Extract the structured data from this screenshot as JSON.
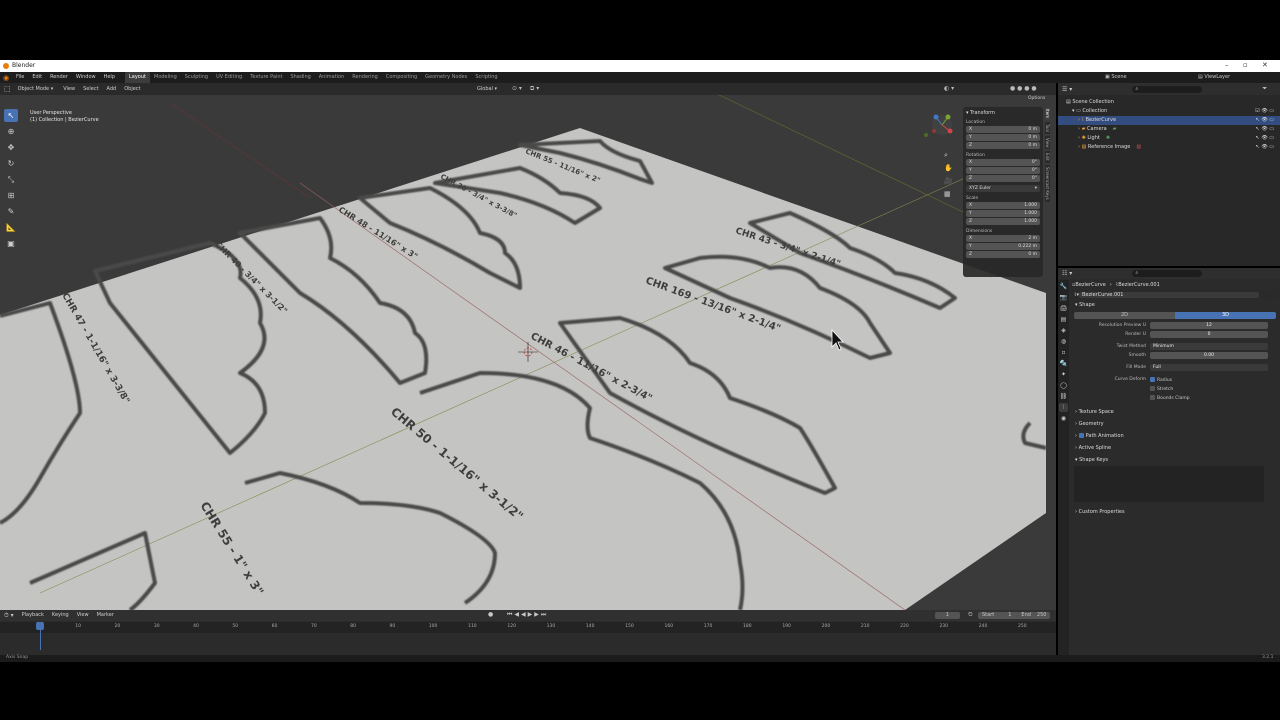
{
  "window": {
    "title": "Blender"
  },
  "menu": [
    "File",
    "Edit",
    "Render",
    "Window",
    "Help"
  ],
  "workspaces": [
    "Layout",
    "Modeling",
    "Sculpting",
    "UV Editing",
    "Texture Paint",
    "Shading",
    "Animation",
    "Rendering",
    "Compositing",
    "Geometry Nodes",
    "Scripting"
  ],
  "scene": {
    "label": "Scene",
    "viewlayer": "ViewLayer"
  },
  "viewport": {
    "mode": "Object Mode",
    "menus": [
      "View",
      "Select",
      "Add",
      "Object"
    ],
    "transform_orientation": "Global",
    "overlay_title": "User Perspective",
    "overlay_sub": "(1) Collection | BezierCurve",
    "options": "Options"
  },
  "profiles": [
    {
      "label": "CHR 55 - 11/16\" x 2\""
    },
    {
      "label": "CHR 30 - 3/4\" x 3-3/8\""
    },
    {
      "label": "CHR 48 - 11/16\" x 3\""
    },
    {
      "label": "CHR 40 - 3/4\" x 3-1/2\""
    },
    {
      "label": "CHR 47 - 1-1/16\" x 3-3/8\""
    },
    {
      "label": "CHR 43 - 3/4\" x 2-1/4\""
    },
    {
      "label": "CHR 169 - 13/16\" x 2-1/4\""
    },
    {
      "label": "CHR 46 - 11/16\" x 2-3/4\""
    },
    {
      "label": "CHR 50 - 1-1/16\" x 3-1/2\""
    },
    {
      "label": "CHR 55 - 1\" x 3\""
    }
  ],
  "npanel": {
    "header": "Transform",
    "location_label": "Location",
    "location": [
      {
        "axis": "X",
        "val": "0 m"
      },
      {
        "axis": "Y",
        "val": "0 m"
      },
      {
        "axis": "Z",
        "val": "0 m"
      }
    ],
    "rotation_label": "Rotation",
    "rotation": [
      {
        "axis": "X",
        "val": "0°"
      },
      {
        "axis": "Y",
        "val": "0°"
      },
      {
        "axis": "Z",
        "val": "0°"
      }
    ],
    "rotation_mode": "XYZ Euler",
    "scale_label": "Scale",
    "scale": [
      {
        "axis": "X",
        "val": "1.000"
      },
      {
        "axis": "Y",
        "val": "1.000"
      },
      {
        "axis": "Z",
        "val": "1.000"
      }
    ],
    "dimensions_label": "Dimensions",
    "dimensions": [
      {
        "axis": "X",
        "val": "2 m"
      },
      {
        "axis": "Y",
        "val": "0.222 m"
      },
      {
        "axis": "Z",
        "val": "0 m"
      }
    ],
    "tabs": [
      "Item",
      "Tool",
      "View",
      "Edit",
      "Screencast Keys"
    ]
  },
  "outliner": {
    "root": "Scene Collection",
    "items": [
      {
        "name": "Collection",
        "indent": 1,
        "selected": false
      },
      {
        "name": "BezierCurve",
        "indent": 2,
        "selected": true
      },
      {
        "name": "Camera",
        "indent": 2,
        "selected": false
      },
      {
        "name": "Light",
        "indent": 2,
        "selected": false
      },
      {
        "name": "Reference Image",
        "indent": 2,
        "selected": false
      }
    ]
  },
  "properties": {
    "breadcrumb_obj": "BezierCurve",
    "breadcrumb_data": "BezierCurve.001",
    "datablock": "BezierCurve.001",
    "shape_section": "Shape",
    "dim_2d": "2D",
    "dim_3d": "3D",
    "resolution_preview_label": "Resolution Preview U",
    "resolution_preview_val": "12",
    "render_u_label": "Render U",
    "render_u_val": "0",
    "twist_method_label": "Twist Method",
    "twist_method_val": "Minimum",
    "smooth_label": "Smooth",
    "smooth_val": "0.00",
    "fill_mode_label": "Fill Mode",
    "fill_mode_val": "Full",
    "curve_deform_label": "Curve Deform",
    "radius_label": "Radius",
    "stretch_label": "Stretch",
    "bounds_clamp_label": "Bounds Clamp",
    "sections": [
      "Texture Space",
      "Geometry",
      "Path Animation",
      "Active Spline",
      "Shape Keys",
      "Custom Properties"
    ]
  },
  "timeline": {
    "menus": [
      "Playback",
      "Keying",
      "View",
      "Marker"
    ],
    "current_frame": "1",
    "start_label": "Start",
    "start": "1",
    "end_label": "End",
    "end": "250",
    "ticks": [
      "0",
      "10",
      "20",
      "30",
      "40",
      "50",
      "60",
      "70",
      "80",
      "90",
      "100",
      "110",
      "120",
      "130",
      "140",
      "150",
      "160",
      "170",
      "180",
      "190",
      "200",
      "210",
      "220",
      "230",
      "240",
      "250"
    ]
  },
  "status": {
    "left": "Axis Snap",
    "version": "3.2.1"
  },
  "colors": {
    "accent": "#4772b3",
    "selection": "#334d80",
    "sheet": "#c4c4c2",
    "outline": "#4a4a48"
  }
}
